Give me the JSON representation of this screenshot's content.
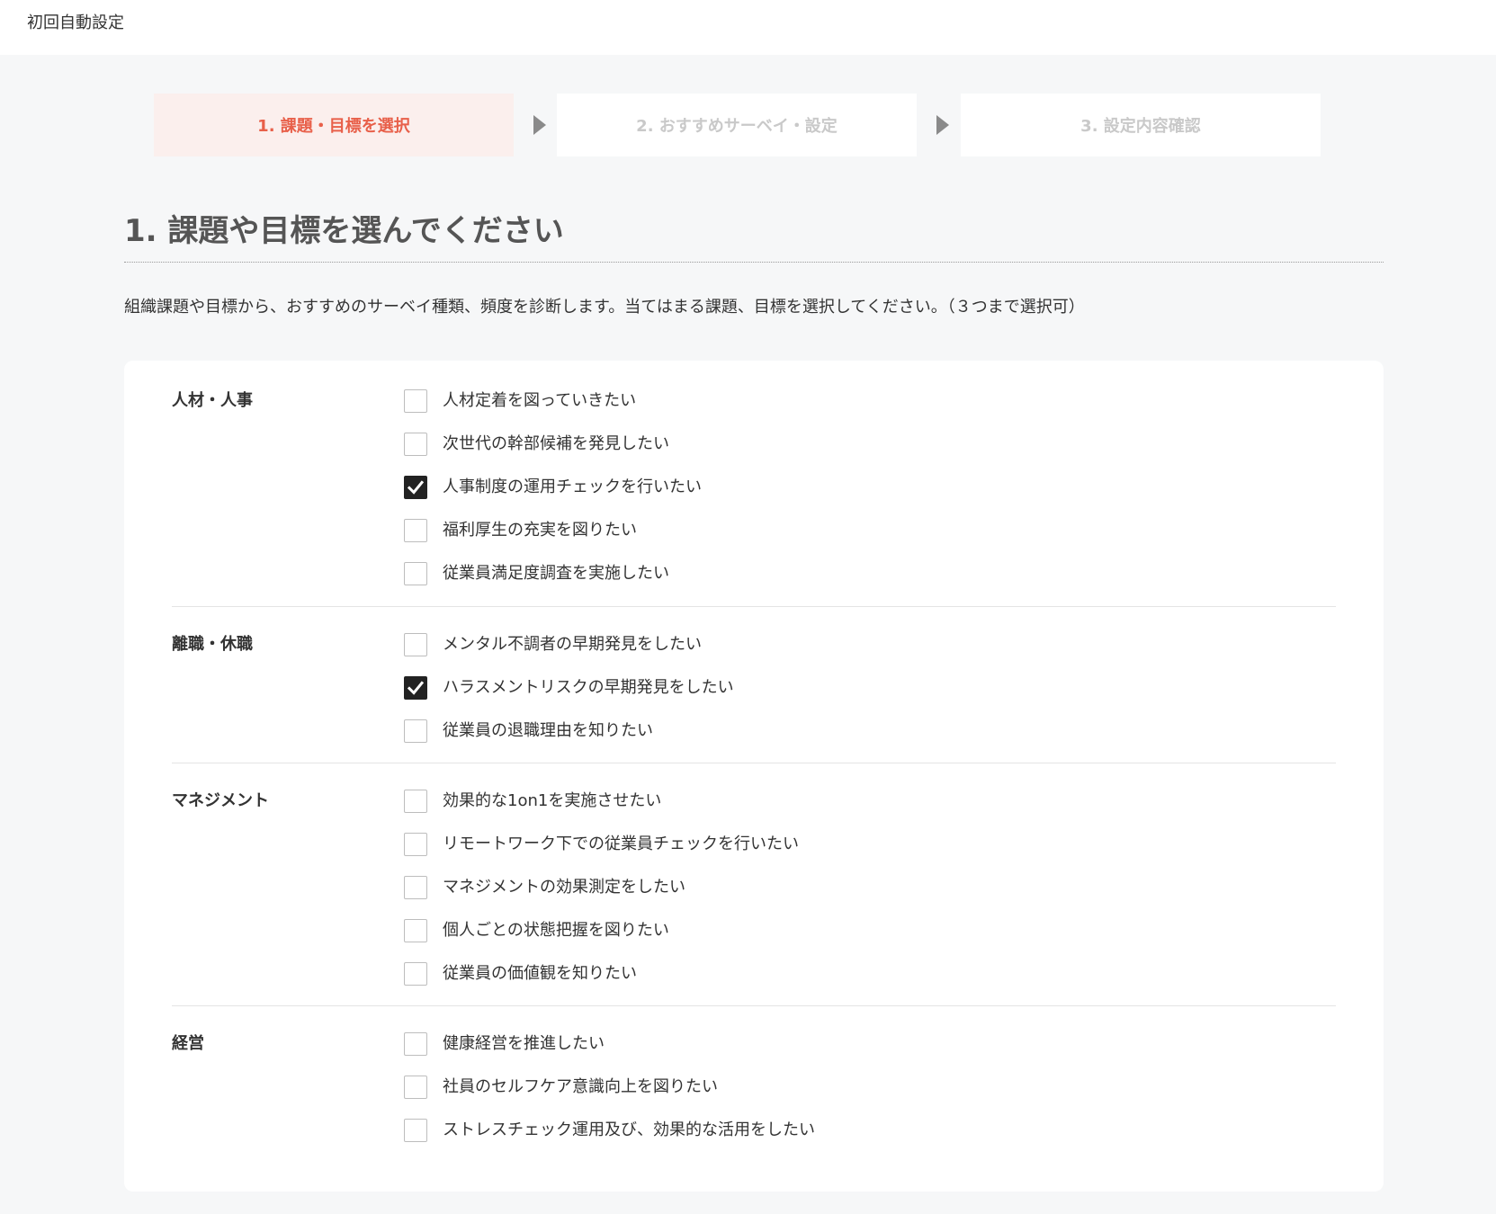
{
  "header": {
    "title": "初回自動設定"
  },
  "stepper": {
    "steps": [
      {
        "label": "1. 課題・目標を選択",
        "active": true
      },
      {
        "label": "2. おすすめサーベイ・設定",
        "active": false
      },
      {
        "label": "3. 設定内容確認",
        "active": false
      }
    ]
  },
  "main": {
    "heading": "1. 課題や目標を選んでください",
    "description": "組織課題や目標から、おすすめのサーベイ種類、頻度を診断します。当てはまる課題、目標を選択してください。（３つまで選択可）"
  },
  "groups": [
    {
      "label": "人材・人事",
      "options": [
        {
          "label": "人材定着を図っていきたい",
          "checked": false
        },
        {
          "label": "次世代の幹部候補を発見したい",
          "checked": false
        },
        {
          "label": "人事制度の運用チェックを行いたい",
          "checked": true
        },
        {
          "label": "福利厚生の充実を図りたい",
          "checked": false
        },
        {
          "label": "従業員満足度調査を実施したい",
          "checked": false
        }
      ]
    },
    {
      "label": "離職・休職",
      "options": [
        {
          "label": "メンタル不調者の早期発見をしたい",
          "checked": false
        },
        {
          "label": "ハラスメントリスクの早期発見をしたい",
          "checked": true
        },
        {
          "label": "従業員の退職理由を知りたい",
          "checked": false
        }
      ]
    },
    {
      "label": "マネジメント",
      "options": [
        {
          "label": "効果的な1on1を実施させたい",
          "checked": false
        },
        {
          "label": "リモートワーク下での従業員チェックを行いたい",
          "checked": false
        },
        {
          "label": "マネジメントの効果測定をしたい",
          "checked": false
        },
        {
          "label": "個人ごとの状態把握を図りたい",
          "checked": false
        },
        {
          "label": "従業員の価値観を知りたい",
          "checked": false
        }
      ]
    },
    {
      "label": "経営",
      "options": [
        {
          "label": "健康経営を推進したい",
          "checked": false
        },
        {
          "label": "社員のセルフケア意識向上を図りたい",
          "checked": false
        },
        {
          "label": "ストレスチェック運用及び、効果的な活用をしたい",
          "checked": false
        }
      ]
    }
  ],
  "colors": {
    "accent": "#e8604a",
    "active_step_bg": "#fbefed",
    "inactive_step_text": "#c9c9c9",
    "page_bg": "#f6f7f8",
    "checkbox_checked": "#222222"
  },
  "icons": {
    "step_arrow": "triangle-right-icon",
    "checkmark": "checkmark-icon"
  }
}
